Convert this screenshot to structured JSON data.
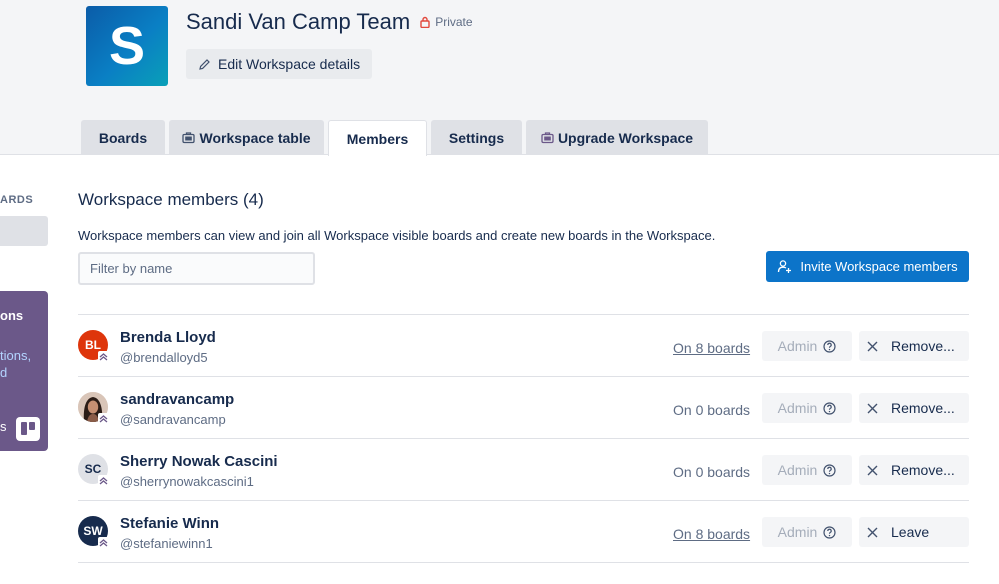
{
  "workspace": {
    "logo_letter": "S",
    "name": "Sandi Van Camp Team",
    "privacy": "Private",
    "edit_label": "Edit Workspace details",
    "colors": {
      "logo_start": "#0b5ca8",
      "logo_end": "#09a0b8",
      "privacy_icon": "#e2483d"
    }
  },
  "tabs": [
    {
      "label": "Boards",
      "icon": "",
      "active": false
    },
    {
      "label": "Workspace table",
      "icon": "briefcase-icon",
      "active": false
    },
    {
      "label": "Members",
      "icon": "",
      "active": true
    },
    {
      "label": "Settings",
      "icon": "",
      "active": false
    },
    {
      "label": "Upgrade Workspace",
      "icon": "briefcase-icon",
      "active": false
    }
  ],
  "sidebar": {
    "section_label_fragment": "ARDS",
    "promo": {
      "title_fragment": "ons",
      "link_line1": "tions,",
      "link_line2": "d",
      "footer_fragment": "s"
    }
  },
  "main": {
    "title": "Workspace members (4)",
    "description": "Workspace members can view and join all Workspace visible boards and create new boards in the Workspace.",
    "filter_placeholder": "Filter by name",
    "invite_label": "Invite Workspace members",
    "accent_color": "#0c74c9"
  },
  "members": [
    {
      "initials": "BL",
      "avatar_bg": "#de350b",
      "avatar_fg": "#ffffff",
      "name": "Brenda Lloyd",
      "username": "@brendalloyd5",
      "boards": "On 8 boards",
      "boards_link": true,
      "role": "Admin",
      "action": "Remove..."
    },
    {
      "initials": "",
      "avatar_bg": "#3b2a22",
      "avatar_fg": "#ffffff",
      "name": "sandravancamp",
      "username": "@sandravancamp",
      "boards": "On 0 boards",
      "boards_link": false,
      "role": "Admin",
      "action": "Remove..."
    },
    {
      "initials": "SC",
      "avatar_bg": "#dfe1e6",
      "avatar_fg": "#172b4d",
      "name": "Sherry Nowak Cascini",
      "username": "@sherrynowakcascini1",
      "boards": "On 0 boards",
      "boards_link": false,
      "role": "Admin",
      "action": "Remove..."
    },
    {
      "initials": "SW",
      "avatar_bg": "#172b4d",
      "avatar_fg": "#ffffff",
      "name": "Stefanie Winn",
      "username": "@stefaniewinn1",
      "boards": "On 8 boards",
      "boards_link": true,
      "role": "Admin",
      "action": "Leave"
    }
  ]
}
